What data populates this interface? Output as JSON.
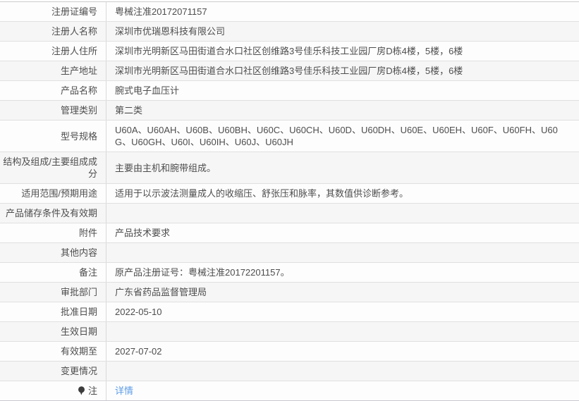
{
  "colors": {
    "link": "#5c9ce6",
    "row_alt_bg": "#f6f6f6",
    "row_bg": "#fdfdfd",
    "border": "#e0e0e0",
    "text": "#4d4d4d"
  },
  "table": {
    "rows": [
      {
        "label": "注册证编号",
        "value": "粤械注准20172071157"
      },
      {
        "label": "注册人名称",
        "value": "深圳市优瑞恩科技有限公司"
      },
      {
        "label": "注册人住所",
        "value": "深圳市光明新区马田街道合水口社区创维路3号佳乐科技工业园厂房D栋4楼，5楼，6楼"
      },
      {
        "label": "生产地址",
        "value": "深圳市光明新区马田街道合水口社区创维路3号佳乐科技工业园厂房D栋4楼，5楼，6楼"
      },
      {
        "label": "产品名称",
        "value": "腕式电子血压计"
      },
      {
        "label": "管理类别",
        "value": "第二类"
      },
      {
        "label": "型号规格",
        "value": "U60A、U60AH、U60B、U60BH、U60C、U60CH、U60D、U60DH、U60E、U60EH、U60F、U60FH、U60G、U60GH、U60I、U60IH、U60J、U60JH",
        "tall": true
      },
      {
        "label": "结构及组成/主要组成成分",
        "value": "主要由主机和腕带组成。"
      },
      {
        "label": "适用范围/预期用途",
        "value": "适用于以示波法测量成人的收缩压、舒张压和脉率，其数值供诊断参考。"
      },
      {
        "label": "产品储存条件及有效期",
        "value": ""
      },
      {
        "label": "附件",
        "value": "产品技术要求"
      },
      {
        "label": "其他内容",
        "value": ""
      },
      {
        "label": "备注",
        "value": "原产品注册证号：粤械注准20172201157。"
      },
      {
        "label": "审批部门",
        "value": "广东省药品监督管理局"
      },
      {
        "label": "批准日期",
        "value": "2022-05-10"
      },
      {
        "label": "生效日期",
        "value": ""
      },
      {
        "label": "有效期至",
        "value": "2027-07-02"
      },
      {
        "label": "变更情况",
        "value": ""
      },
      {
        "label": "注",
        "value": "详情",
        "value_is_link": true,
        "label_icon": "bulb-icon"
      }
    ]
  }
}
